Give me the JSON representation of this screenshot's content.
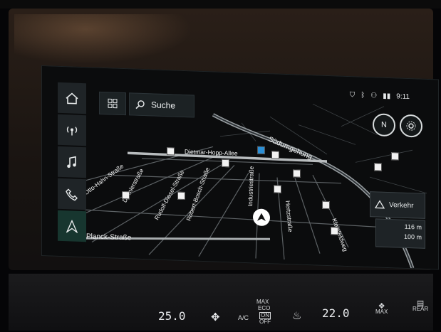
{
  "status_bar": {
    "time": "9:11"
  },
  "toolbar": {
    "search_label": "Suche"
  },
  "side_menu": [
    {
      "icon": "home-icon"
    },
    {
      "icon": "radio-icon"
    },
    {
      "icon": "music-note-icon"
    },
    {
      "icon": "phone-icon"
    },
    {
      "icon": "navigation-arrow-icon"
    }
  ],
  "map": {
    "compass_label": "N",
    "streets": [
      "Otto-Hahn-Straße",
      "Daimlerstraße",
      "Rudolf-Diesel-Straße",
      "Robert-Bosch-Straße",
      "Industriestraße",
      "Dietmar-Hopp-Allee",
      "Südumgehung",
      "Planck-Straße",
      "Kleinfeldweg",
      "Hertzstraße"
    ]
  },
  "traffic": {
    "label": "Verkehr"
  },
  "elevation": {
    "altitude": "116 m",
    "distance": "100 m"
  },
  "climate": {
    "left_temp": "25.0",
    "right_temp": "22.0",
    "ac_label": "A/C",
    "ac_modes": {
      "max": "MAX",
      "eco": "ECO",
      "on": "ON",
      "off": "OFF"
    },
    "front_defrost": "MAX",
    "rear_defrost": "REAR"
  },
  "colors": {
    "accent": "#2d6b5a",
    "map_road": "#8a8f92",
    "map_bg": "#0b0c0d"
  }
}
